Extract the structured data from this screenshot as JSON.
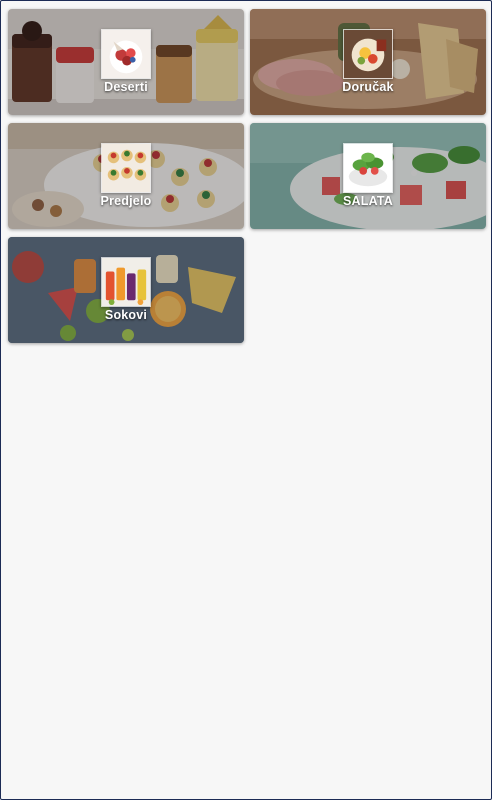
{
  "categories": [
    {
      "label": "Deserti",
      "icon": "desserts-image"
    },
    {
      "label": "Doručak",
      "icon": "breakfast-image"
    },
    {
      "label": "Predjelo",
      "icon": "appetizer-image"
    },
    {
      "label": "SALATA",
      "icon": "salad-image"
    },
    {
      "label": "Sokovi",
      "icon": "juices-image"
    }
  ],
  "colors": {
    "page_background": "#f7f7f7",
    "frame_border": "#1c2b55",
    "label_text": "#ffffff"
  }
}
